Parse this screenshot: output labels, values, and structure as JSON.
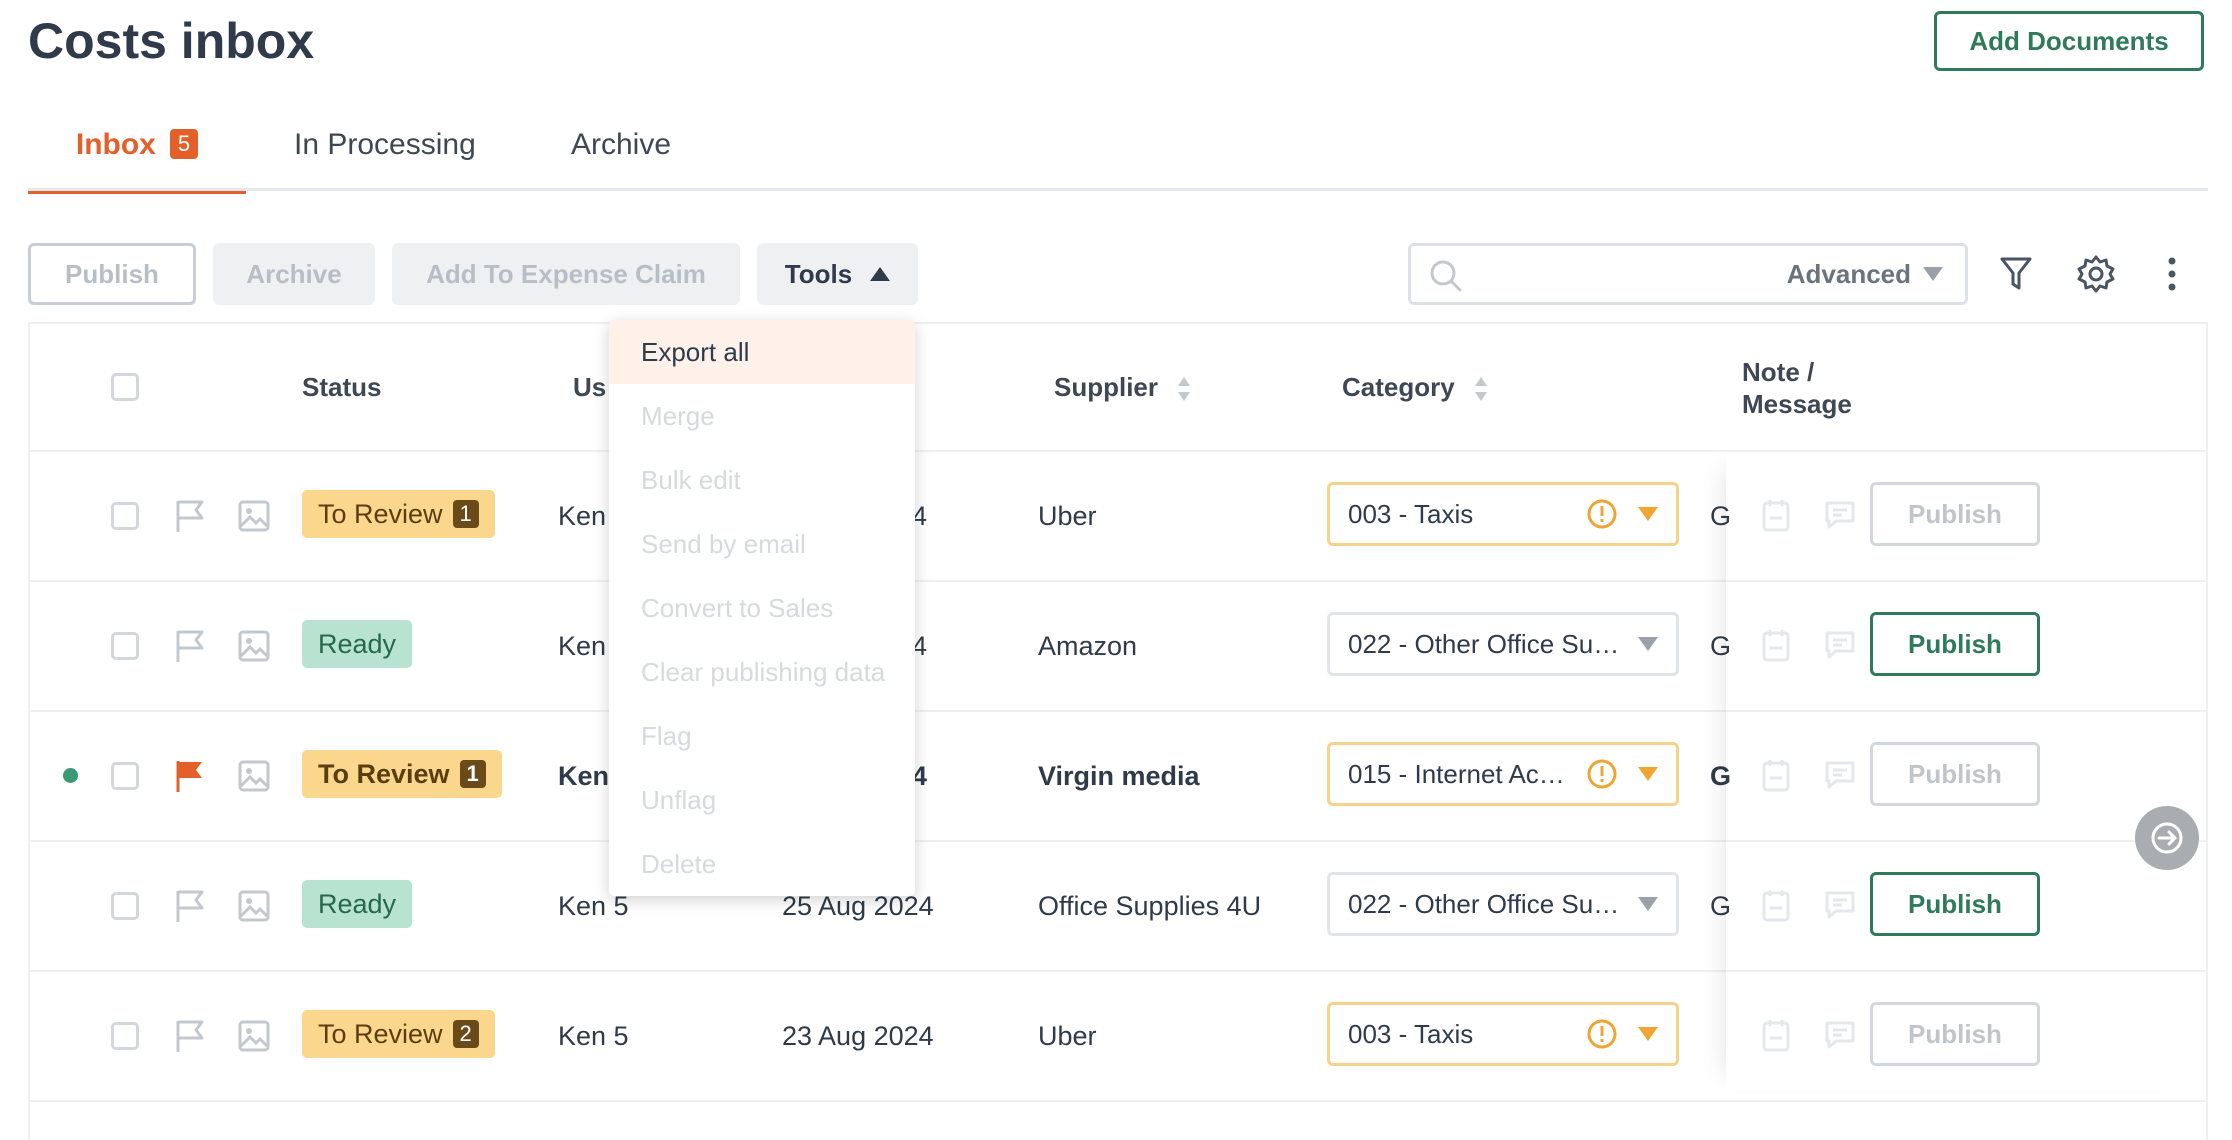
{
  "page": {
    "title": "Costs inbox",
    "add_documents": "Add Documents"
  },
  "tabs": [
    {
      "label": "Inbox",
      "badge": "5"
    },
    {
      "label": "In Processing"
    },
    {
      "label": "Archive"
    }
  ],
  "toolbar": {
    "publish": "Publish",
    "archive": "Archive",
    "add_to_expense_claim": "Add To Expense Claim",
    "tools": "Tools",
    "advanced": "Advanced"
  },
  "tools_menu": [
    "Export all",
    "Merge",
    "Bulk edit",
    "Send by email",
    "Convert to Sales",
    "Clear publishing data",
    "Flag",
    "Unflag",
    "Delete"
  ],
  "columns": {
    "status": "Status",
    "user": "Us",
    "supplier": "Supplier",
    "category": "Category",
    "note": "Note /",
    "note2": "Message"
  },
  "rows": [
    {
      "status": "To Review",
      "count": "1",
      "user": "Ken",
      "date": "4",
      "supplier": "Uber",
      "category": "003 - Taxis",
      "extra": "G",
      "publish": "Publish"
    },
    {
      "status": "Ready",
      "user": "Ken",
      "date": "4",
      "supplier": "Amazon",
      "category": "022 - Other Office Su…",
      "extra": "G",
      "publish": "Publish"
    },
    {
      "status": "To Review",
      "count": "1",
      "user": "Ken",
      "date": "4",
      "supplier": "Virgin media",
      "category": "015 - Internet Ac…",
      "extra": "G",
      "publish": "Publish"
    },
    {
      "status": "Ready",
      "user": "Ken 5",
      "date": "25 Aug 2024",
      "supplier": "Office Supplies 4U",
      "category": "022 - Other Office Su…",
      "extra": "G",
      "publish": "Publish"
    },
    {
      "status": "To Review",
      "count": "2",
      "user": "Ken 5",
      "date": "23 Aug 2024",
      "supplier": "Uber",
      "category": "003 - Taxis",
      "extra": "",
      "publish": "Publish"
    }
  ],
  "colors": {
    "accent": "#e4602a",
    "green": "#2f7a5b",
    "review": "#fbd78d",
    "ready": "#b9e3d1"
  }
}
